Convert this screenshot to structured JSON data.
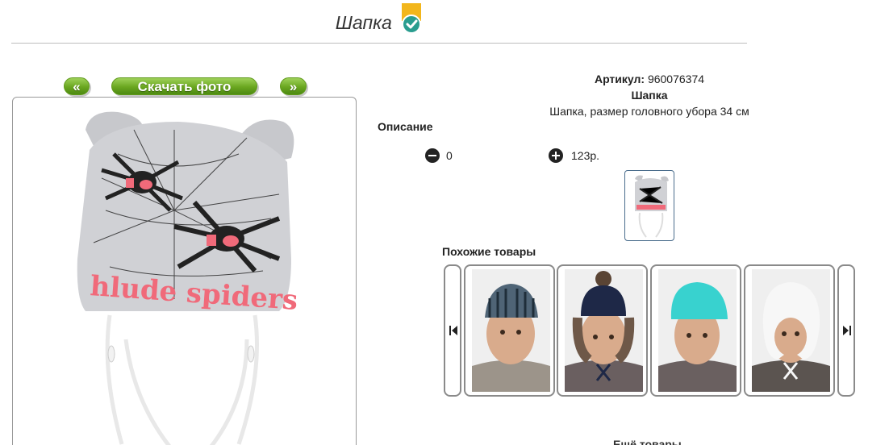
{
  "product": {
    "title": "Шапка",
    "article_label": "Артикул:",
    "article_value": "960076374",
    "name": "Шапка",
    "description": "Шапка, размер головного убора 34 см",
    "description_label": "Описание"
  },
  "gallery": {
    "prev_label": "«",
    "download_label": "Скачать фото",
    "next_label": "»"
  },
  "order": {
    "quantity": "0",
    "price": "123р."
  },
  "similar": {
    "title": "Похожие товары"
  },
  "more_label": "Ещё товары"
}
